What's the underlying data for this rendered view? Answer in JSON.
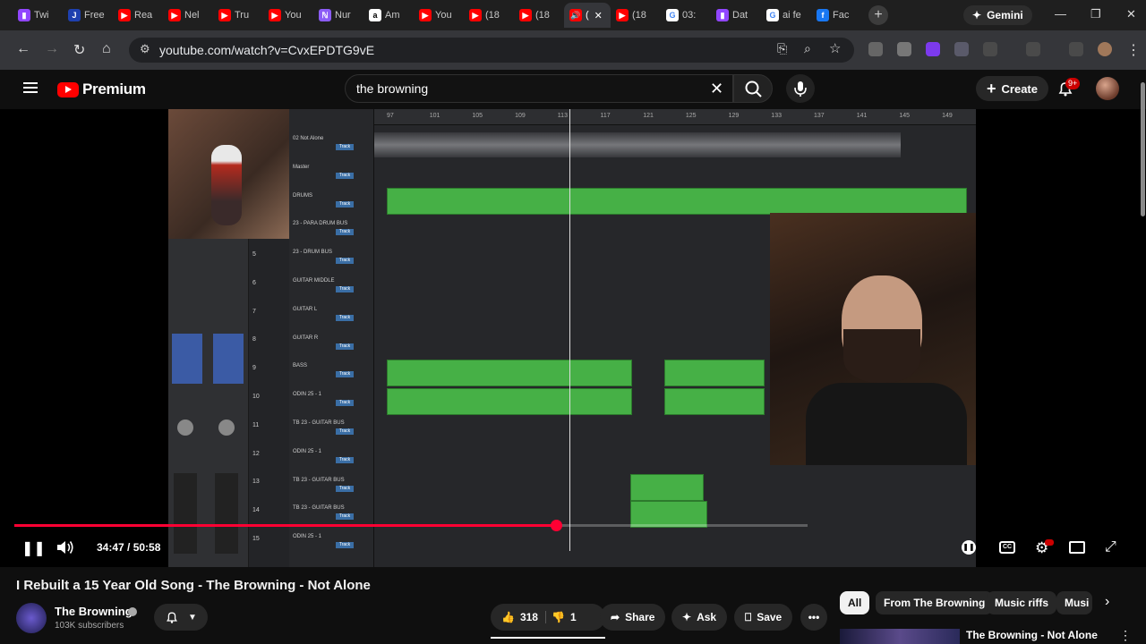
{
  "browser": {
    "tabs": [
      {
        "label": "Twi",
        "fav": "tw",
        "glyph": "▮",
        "active": false
      },
      {
        "label": "Free",
        "fav": "j",
        "glyph": "J",
        "active": false
      },
      {
        "label": "Rea",
        "fav": "yt",
        "glyph": "▶",
        "active": false
      },
      {
        "label": "Nel",
        "fav": "yt",
        "glyph": "▶",
        "active": false
      },
      {
        "label": "Tru",
        "fav": "yt",
        "glyph": "▶",
        "active": false
      },
      {
        "label": "You",
        "fav": "yt",
        "glyph": "▶",
        "active": false
      },
      {
        "label": "Nur",
        "fav": "nu",
        "glyph": "ℕ",
        "active": false
      },
      {
        "label": "Am",
        "fav": "am",
        "glyph": "a",
        "active": false
      },
      {
        "label": "You",
        "fav": "yt",
        "glyph": "▶",
        "active": false
      },
      {
        "label": "(18",
        "fav": "yt",
        "glyph": "▶",
        "active": false
      },
      {
        "label": "(18",
        "fav": "yt",
        "glyph": "▶",
        "active": false
      },
      {
        "label": "(",
        "fav": "yt",
        "glyph": "🔊",
        "active": true
      },
      {
        "label": "(18",
        "fav": "yt",
        "glyph": "▶",
        "active": false
      },
      {
        "label": "03:",
        "fav": "g",
        "glyph": "G",
        "active": false
      },
      {
        "label": "Dat",
        "fav": "tw",
        "glyph": "▮",
        "active": false
      },
      {
        "label": "ai fe",
        "fav": "g",
        "glyph": "G",
        "active": false
      },
      {
        "label": "Fac",
        "fav": "fb",
        "glyph": "f",
        "active": false
      }
    ],
    "new_tab": "+",
    "gemini_label": "Gemini",
    "url": "youtube.com/watch?v=CvxEPDTG9vE"
  },
  "youtube": {
    "logo_text": "Premium",
    "search_value": "the browning",
    "create_label": "Create",
    "notifications_badge": "9+"
  },
  "video": {
    "current_time": "34:47",
    "duration": "50:58",
    "time_display": "34:47 / 50:58",
    "progress": 0.6825,
    "title": "I Rebuilt a 15 Year Old Song - The Browning - Not Alone"
  },
  "daw": {
    "ruler_ticks": [
      "97",
      "101",
      "105",
      "109",
      "113",
      "117",
      "121",
      "125",
      "129",
      "133",
      "137",
      "141",
      "145",
      "149"
    ],
    "tracks": [
      {
        "name": "02 Not Alone",
        "btn": "Track"
      },
      {
        "name": "Master",
        "btn": "Track"
      },
      {
        "name": "DRUMS",
        "btn": "Track"
      },
      {
        "name": "23 - PARA DRUM BUS",
        "btn": "Track"
      },
      {
        "name": "23 - DRUM BUS",
        "btn": "Track"
      },
      {
        "name": "GUITAR MIDDLE",
        "btn": "Track"
      },
      {
        "name": "GUITAR L",
        "btn": "Track"
      },
      {
        "name": "GUITAR R",
        "btn": "Track"
      },
      {
        "name": "BASS",
        "btn": "Track"
      },
      {
        "name": "ODIN 25 - 1",
        "btn": "Track"
      },
      {
        "name": "TB 23 - GUITAR BUS",
        "btn": "Track"
      },
      {
        "name": "ODIN 25 - 1",
        "btn": "Track"
      },
      {
        "name": "TB 23 - GUITAR BUS",
        "btn": "Track"
      },
      {
        "name": "TB 23 - GUITAR BUS",
        "btn": "Track"
      },
      {
        "name": "ODIN 25 - 1",
        "btn": "Track"
      }
    ],
    "track_numbers": [
      "5",
      "6",
      "7",
      "8",
      "9",
      "10",
      "11",
      "12",
      "13",
      "14",
      "15"
    ]
  },
  "channel": {
    "name": "The Browning",
    "subscribers": "103K subscribers"
  },
  "actions": {
    "likes": "318",
    "dislikes": "1",
    "share": "Share",
    "ask": "Ask",
    "save": "Save"
  },
  "chips": [
    "All",
    "From The Browning",
    "Music riffs",
    "Musi"
  ],
  "recommendation": {
    "title": "The Browning - Not Alone"
  }
}
